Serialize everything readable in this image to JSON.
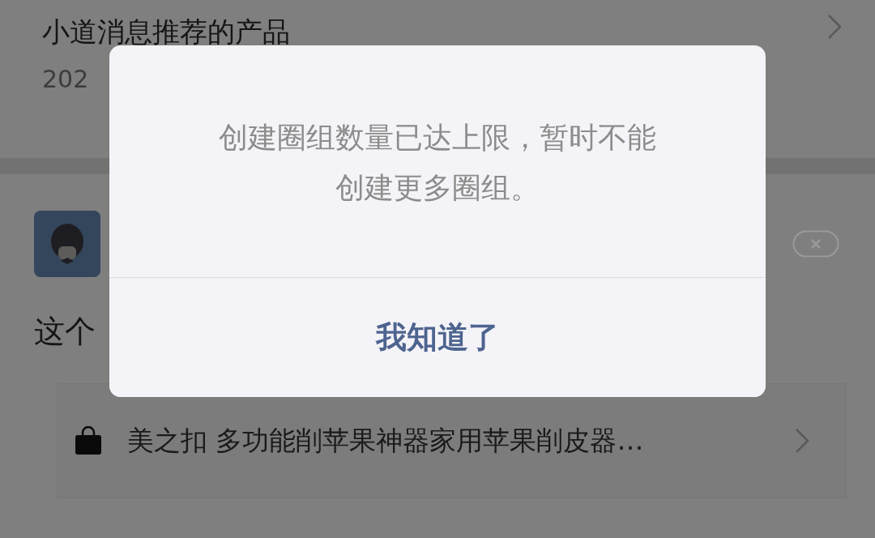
{
  "background": {
    "recommend": {
      "title": "小道消息推荐的产品",
      "subtitle": "202"
    },
    "post": {
      "text": "这个"
    },
    "product": {
      "name": "美之扣 多功能削苹果神器家用苹果削皮器…"
    }
  },
  "dialog": {
    "message": "创建圈组数量已达上限，暂时不能创建更多圈组。",
    "button": "我知道了"
  }
}
